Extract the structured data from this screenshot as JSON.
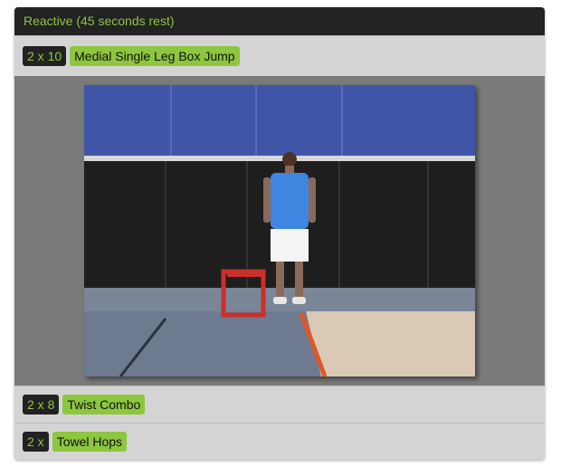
{
  "section": {
    "title": "Reactive (45 seconds rest)"
  },
  "exercises": [
    {
      "sets": "2 x 10",
      "name": "Medial Single Leg Box Jump"
    },
    {
      "sets": "2 x 8",
      "name": "Twist Combo"
    },
    {
      "sets": "2 x",
      "name": "Towel Hops"
    }
  ],
  "colors": {
    "accent": "#8dc63f",
    "header_bg": "#222222",
    "row_bg": "#d4d4d4"
  }
}
